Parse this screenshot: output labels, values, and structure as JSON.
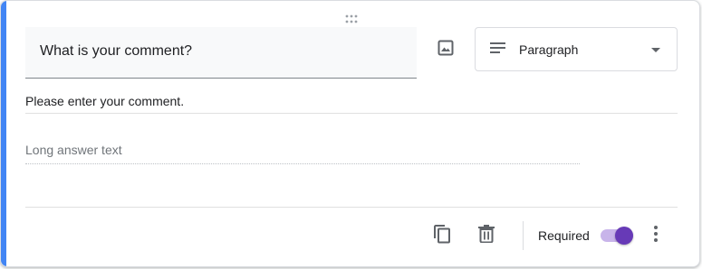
{
  "question": {
    "title": "What is your comment?",
    "description": "Please enter your comment.",
    "answer_placeholder": "Long answer text"
  },
  "type_select": {
    "selected": "Paragraph",
    "icon": "paragraph-lines-icon"
  },
  "footer": {
    "required_label": "Required",
    "required_on": true
  },
  "icons": {
    "drag": "drag-handle-icon",
    "image": "image-icon",
    "duplicate": "duplicate-icon",
    "delete": "trash-icon",
    "more": "more-vert-icon"
  },
  "colors": {
    "accent": "#4285f4",
    "toggle_thumb": "#673ab7",
    "toggle_track": "#c8b4ea"
  }
}
